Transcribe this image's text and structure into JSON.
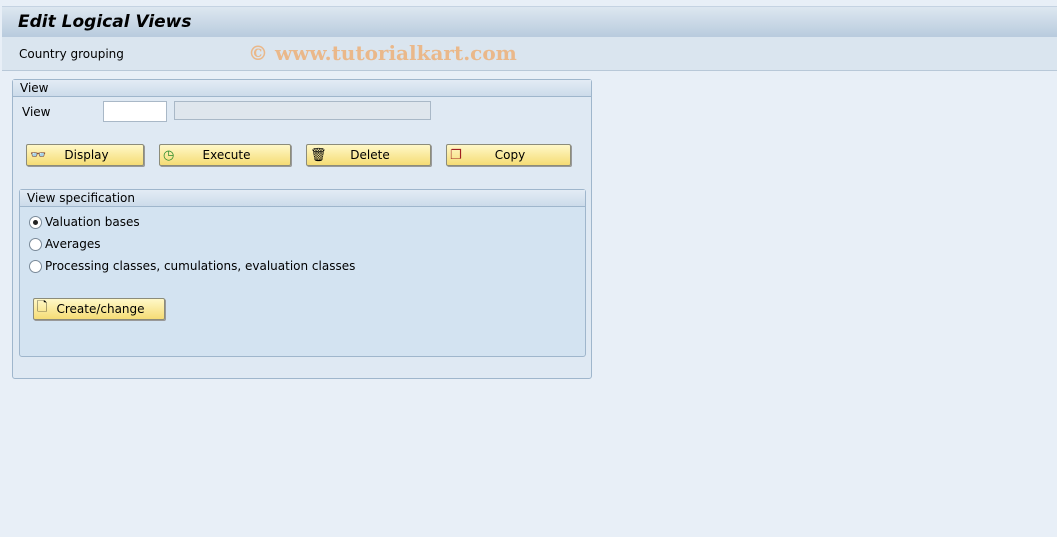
{
  "title": "Edit Logical Views",
  "subbar": {
    "item": "Country grouping",
    "watermark": "© www.tutorialkart.com"
  },
  "view_group": {
    "header": "View",
    "field_label": "View",
    "field_value": "",
    "description": ""
  },
  "buttons": [
    {
      "label": "Display",
      "icon": "glasses-icon"
    },
    {
      "label": "Execute",
      "icon": "execute-clock-icon"
    },
    {
      "label": "Delete",
      "icon": "trash-icon"
    },
    {
      "label": "Copy",
      "icon": "copy-icon"
    }
  ],
  "spec_group": {
    "header": "View specification",
    "options": [
      {
        "label": "Valuation bases",
        "selected": true
      },
      {
        "label": "Averages",
        "selected": false
      },
      {
        "label": "Processing classes, cumulations, evaluation classes",
        "selected": false
      }
    ],
    "button": "Create/change"
  }
}
